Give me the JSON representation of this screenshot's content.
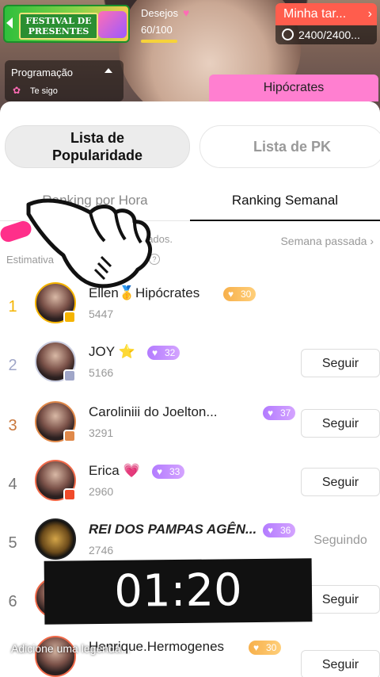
{
  "top": {
    "banner_line1": "FESTIVAL DE",
    "banner_line2": "PRESENTES",
    "wishes_label": "Desejos",
    "wishes_count": "60/100",
    "wishes_progress": 0.6,
    "task_label": "Minha tar...",
    "task_timer": "2400/2400...",
    "programming_label": "Programação",
    "programming_sub": "Te sigo",
    "streamer_button": "Hipócrates"
  },
  "segments": {
    "popularity_line1": "Lista de",
    "popularity_line2": "Popularidade",
    "pk": "Lista de PK"
  },
  "tabs": {
    "hourly": "Ranking por Hora",
    "weekly": "Ranking Semanal"
  },
  "info": {
    "rewards": "pensados.",
    "estimate": "Estimativa",
    "last_week": "Semana passada"
  },
  "rows": [
    {
      "rank": "1",
      "name": "Ellen🥇Hipócrates",
      "score": "5447",
      "level": "30",
      "follow": ""
    },
    {
      "rank": "2",
      "name": "JOY ⭐",
      "score": "5166",
      "level": "32",
      "follow": "Seguir"
    },
    {
      "rank": "3",
      "name": "Caroliniii do Joelton...",
      "score": "3291",
      "level": "37",
      "follow": "Seguir"
    },
    {
      "rank": "4",
      "name": "Erica 💗",
      "score": "2960",
      "level": "33",
      "follow": "Seguir"
    },
    {
      "rank": "5",
      "name": "REI DOS PAMPAS AGÊN...",
      "score": "2746",
      "level": "36",
      "follow": "Seguindo"
    },
    {
      "rank": "6",
      "name": "",
      "score": "",
      "level": "",
      "follow": "Seguir"
    },
    {
      "rank": "",
      "name": "Henrique.Hermogenes",
      "score": "",
      "level": "30",
      "follow": "Seguir"
    }
  ],
  "overlay": {
    "timer": "01:20",
    "caption": "Adicione uma legenda..."
  },
  "colors": {
    "gold": "#f5b400",
    "silver": "#a0a6c8",
    "bronze": "#c9773b",
    "pink": "#ff7fd0",
    "task": "#ff5d4d"
  }
}
